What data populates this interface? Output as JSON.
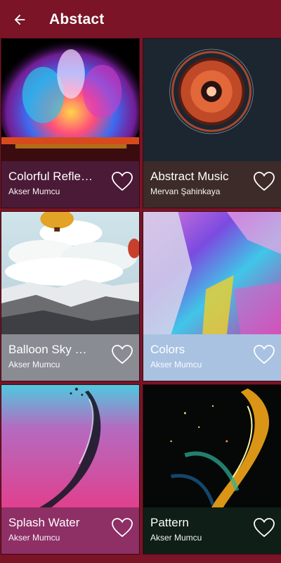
{
  "header": {
    "title": "Abstact",
    "back_icon": "arrow-left-icon"
  },
  "wallpapers": [
    {
      "name": "Colorful Refle…",
      "author": "Akser Mumcu",
      "bg": "#4a1a36"
    },
    {
      "name": "Abstract Music",
      "author": "Mervan Şahinkaya",
      "bg": "#3c2b28"
    },
    {
      "name": "Balloon Sky …",
      "author": "Akser Mumcu",
      "bg": "#8a8c94"
    },
    {
      "name": "Colors",
      "author": "Akser Mumcu",
      "bg": "#a9c2e2"
    },
    {
      "name": "Splash Water",
      "author": "Akser Mumcu",
      "bg": "#8e2f66"
    },
    {
      "name": "Pattern",
      "author": "Akser Mumcu",
      "bg": "#0f1e16"
    }
  ]
}
